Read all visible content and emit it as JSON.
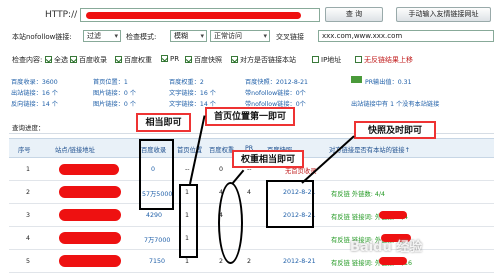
{
  "top": {
    "http_label": "HTTP://",
    "query_button": "查  询",
    "manual_button": "手动输入友情链接网址"
  },
  "filters": {
    "nofollow_label": "本站nofollow链接:",
    "nofollow_value": "过滤",
    "mode_label": "检查模式:",
    "mode_value": "模糊",
    "access_value": "正常访问",
    "cross_label": "交叉链接",
    "cross_value": "xxx.com,www.xxx.com"
  },
  "check": {
    "label": "检查内容:",
    "items": [
      "全选",
      "百度收录",
      "百度权重",
      "PR",
      "百度快照",
      "对方是否链接本站",
      "IP地址",
      "无反链结果上移"
    ]
  },
  "summary": {
    "baidu_index": "百度收录：3600",
    "homepage_pos": "首页位置：1",
    "baidu_weight": "百度权重：2",
    "baidu_snapshot": "百度快照：2012-8-21",
    "pr_value": "PR输出值：0.31",
    "out_links": "出站链接：16 个",
    "image_links": "图片链接：0 个",
    "text_links": "文字链接：16 个",
    "nofollow_links": "带nofollow链接：0个",
    "anti_links": "反向链接：14 个",
    "image_links2": "图片链接：0 个",
    "text_links2": "文字链接：14 个",
    "nofollow_links2": "带nofollow链接：0个",
    "out_note": "出站链接中有 1 个没有本站链接",
    "progress_label": "查询进度："
  },
  "table": {
    "headers": [
      "序号",
      "站点/链接地址",
      "百度收录",
      "首页位置",
      "百度权重",
      "PR",
      "百度快照",
      "对方链接是否有本站的链接↑"
    ],
    "rows": [
      {
        "no": "1",
        "index": "0",
        "pos": "--",
        "weight": "0",
        "pr": "--",
        "snapshot": "",
        "status": "无首页收录"
      },
      {
        "no": "2",
        "index": "57万5000",
        "pos": "1",
        "weight": "4",
        "pr": "4",
        "snapshot": "2012-8-21",
        "status": "有反链 外链数: 4/4"
      },
      {
        "no": "3",
        "index": "4290",
        "pos": "1",
        "weight": "4",
        "pr": "",
        "snapshot": "2012-8-21",
        "status": "有反链 链接词: 外链数: 4/4"
      },
      {
        "no": "4",
        "index": "7万7000",
        "pos": "1",
        "weight": "",
        "pr": "",
        "snapshot": "",
        "status": "有反链 链接词: 外链数: 4/4"
      },
      {
        "no": "5",
        "index": "7150",
        "pos": "1",
        "weight": "2",
        "pr": "2",
        "snapshot": "2012-8-21",
        "status": "有反链 链接词: 外链数: 4/16"
      }
    ]
  },
  "callouts": {
    "c1": "相当即可",
    "c2": "首页位置第一即可",
    "c3": "权重相当即可",
    "c4": "快照及时即可"
  },
  "watermark": "Baidu 经验"
}
